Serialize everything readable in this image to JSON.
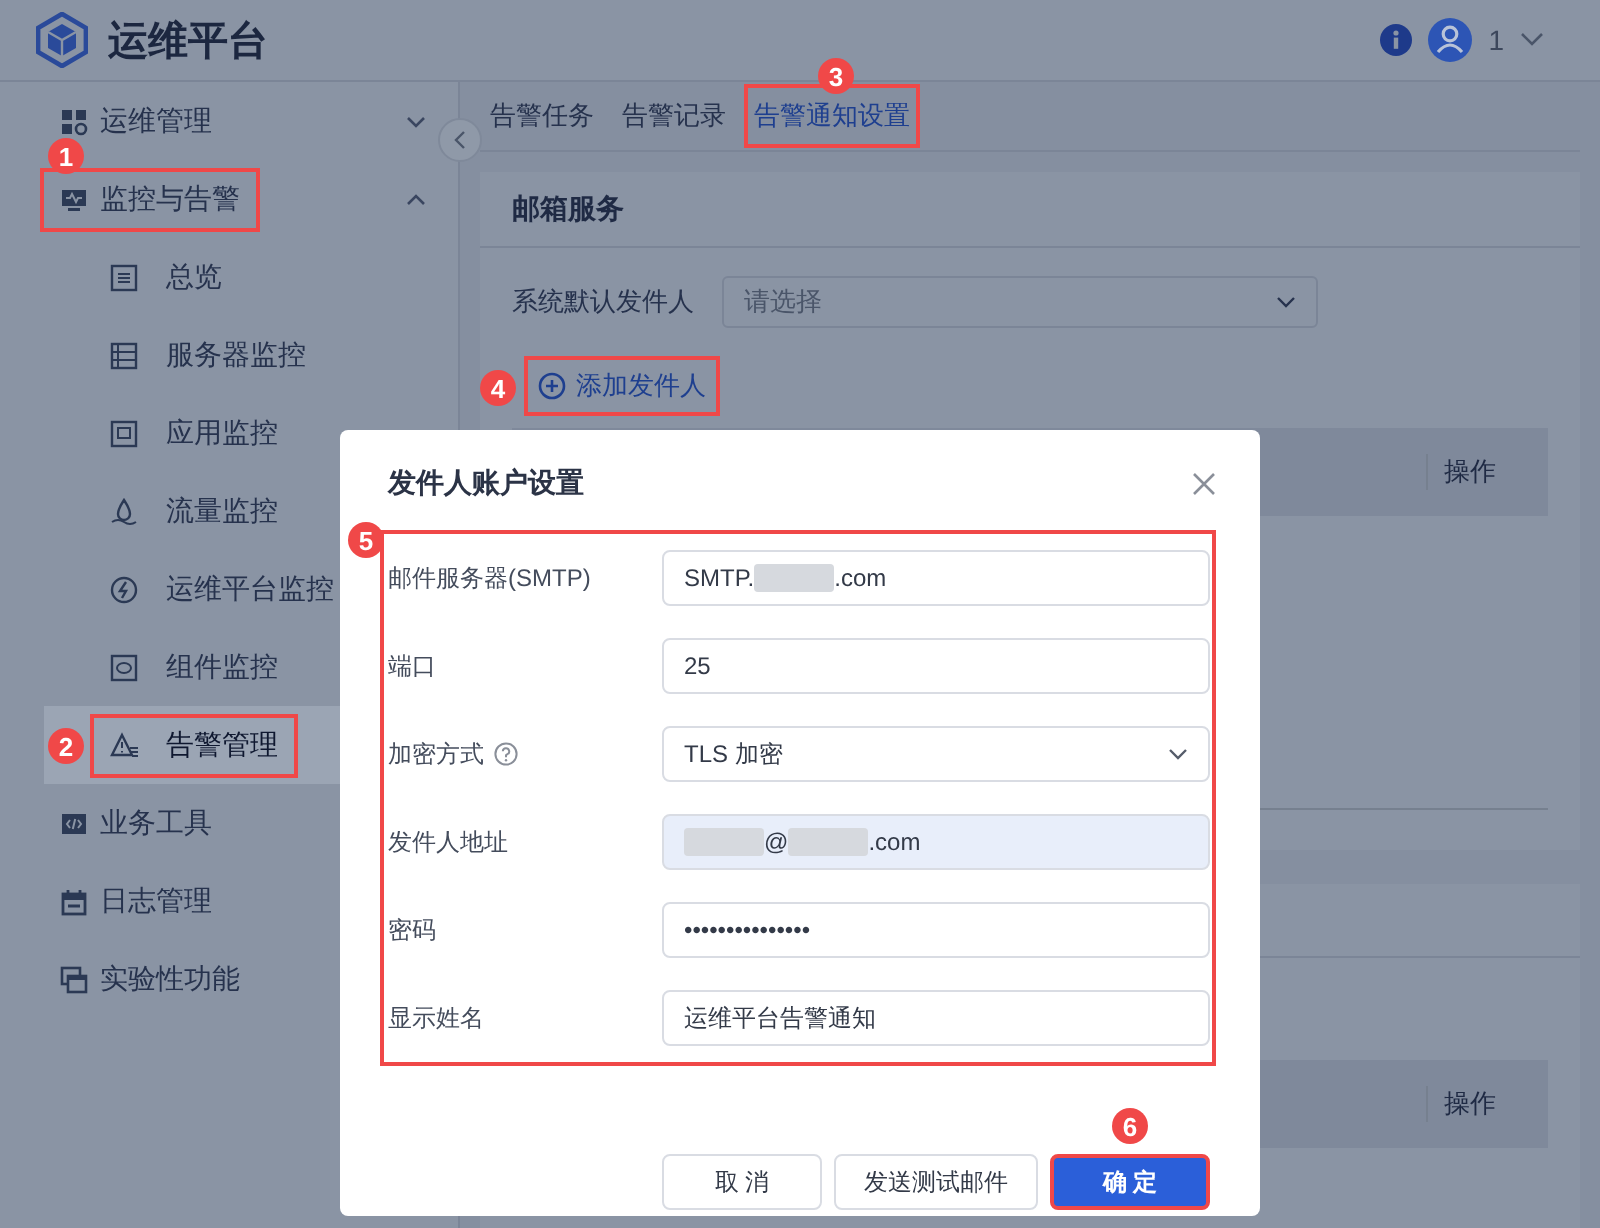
{
  "app": {
    "title": "运维平台",
    "user": "1"
  },
  "sidebar": {
    "items": [
      {
        "label": "运维管理",
        "expanded": false,
        "selected": false
      },
      {
        "label": "监控与告警",
        "expanded": true,
        "selected": false,
        "badge": "1",
        "children": [
          {
            "label": "总览",
            "selected": false
          },
          {
            "label": "服务器监控",
            "selected": false
          },
          {
            "label": "应用监控",
            "selected": false
          },
          {
            "label": "流量监控",
            "selected": false
          },
          {
            "label": "运维平台监控",
            "selected": false
          },
          {
            "label": "组件监控",
            "selected": false
          },
          {
            "label": "告警管理",
            "selected": true,
            "badge": "2"
          }
        ]
      },
      {
        "label": "业务工具",
        "selected": false
      },
      {
        "label": "日志管理",
        "selected": false
      },
      {
        "label": "实验性功能",
        "selected": false
      }
    ]
  },
  "tabs": [
    {
      "label": "告警任务",
      "selected": false
    },
    {
      "label": "告警记录",
      "selected": false
    },
    {
      "label": "告警通知设置",
      "selected": true,
      "badge": "3"
    }
  ],
  "mail_service": {
    "title": "邮箱服务",
    "default_sender": {
      "label": "系统默认发件人",
      "placeholder": "请选择"
    },
    "add_sender": {
      "label": "添加发件人",
      "badge": "4"
    },
    "table": {
      "columns": [
        "操作"
      ]
    }
  },
  "second_section": {
    "table": {
      "columns": [
        "操作"
      ]
    }
  },
  "dialog": {
    "title": "发件人账户设置",
    "form_badge": "5",
    "fields": [
      {
        "kind": "text",
        "label": "邮件服务器(SMTP)",
        "autofilled": false,
        "value_parts": [
          {
            "kind": "text",
            "text": "SMTP."
          },
          {
            "kind": "redacted"
          },
          {
            "kind": "text",
            "text": ".com"
          }
        ]
      },
      {
        "kind": "text",
        "label": "端口",
        "autofilled": false,
        "value_parts": [
          {
            "kind": "text",
            "text": "25"
          }
        ]
      },
      {
        "kind": "select",
        "label": "加密方式",
        "help": true,
        "autofilled": false,
        "value_parts": [
          {
            "kind": "text",
            "text": "TLS 加密"
          }
        ]
      },
      {
        "kind": "text",
        "label": "发件人地址",
        "autofilled": true,
        "value_parts": [
          {
            "kind": "redacted"
          },
          {
            "kind": "text",
            "text": "@"
          },
          {
            "kind": "redacted"
          },
          {
            "kind": "text",
            "text": ".com"
          }
        ]
      },
      {
        "kind": "password",
        "label": "密码",
        "autofilled": false,
        "value_parts": [
          {
            "kind": "text",
            "text": "•••••••••••••••"
          }
        ]
      },
      {
        "kind": "text",
        "label": "显示姓名",
        "autofilled": false,
        "value_parts": [
          {
            "kind": "text",
            "text": "运维平台告警通知"
          }
        ]
      }
    ],
    "buttons": [
      {
        "label": "取 消",
        "kind": "default"
      },
      {
        "label": "发送测试邮件",
        "kind": "default"
      },
      {
        "label": "确 定",
        "kind": "primary",
        "badge": "6"
      }
    ]
  }
}
